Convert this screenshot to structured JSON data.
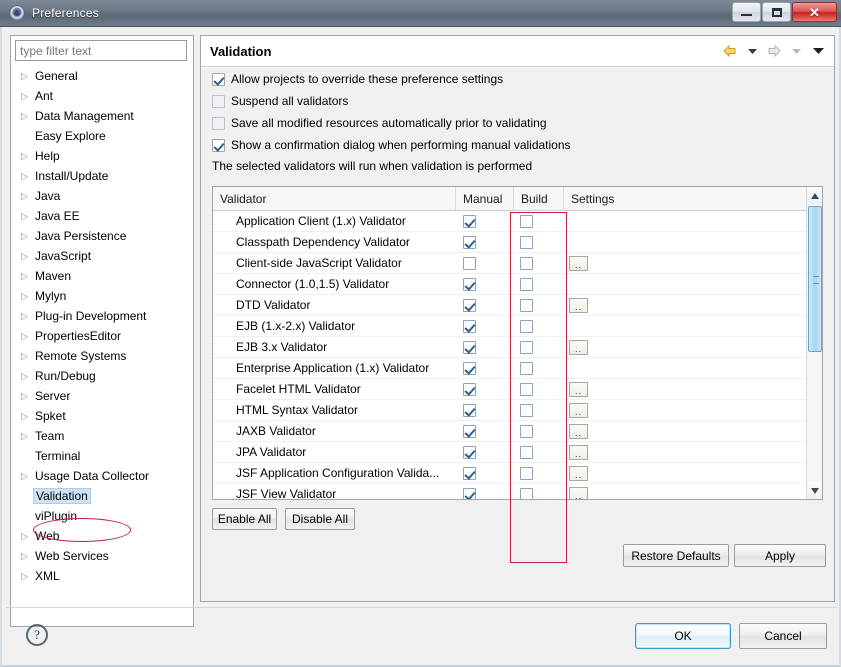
{
  "window": {
    "title": "Preferences",
    "icon": "preferences-gear-icon",
    "controls": {
      "minimize": "minimize-icon",
      "maximize": "maximize-icon",
      "close": "✕"
    }
  },
  "sidebar": {
    "filter_placeholder": "type filter text",
    "filter_value": "",
    "items": [
      {
        "label": "General",
        "expandable": true,
        "selected": false
      },
      {
        "label": "Ant",
        "expandable": true,
        "selected": false
      },
      {
        "label": "Data Management",
        "expandable": true,
        "selected": false
      },
      {
        "label": "Easy Explore",
        "expandable": false,
        "selected": false
      },
      {
        "label": "Help",
        "expandable": true,
        "selected": false
      },
      {
        "label": "Install/Update",
        "expandable": true,
        "selected": false
      },
      {
        "label": "Java",
        "expandable": true,
        "selected": false
      },
      {
        "label": "Java EE",
        "expandable": true,
        "selected": false
      },
      {
        "label": "Java Persistence",
        "expandable": true,
        "selected": false
      },
      {
        "label": "JavaScript",
        "expandable": true,
        "selected": false
      },
      {
        "label": "Maven",
        "expandable": true,
        "selected": false
      },
      {
        "label": "Mylyn",
        "expandable": true,
        "selected": false
      },
      {
        "label": "Plug-in Development",
        "expandable": true,
        "selected": false
      },
      {
        "label": "PropertiesEditor",
        "expandable": true,
        "selected": false
      },
      {
        "label": "Remote Systems",
        "expandable": true,
        "selected": false
      },
      {
        "label": "Run/Debug",
        "expandable": true,
        "selected": false
      },
      {
        "label": "Server",
        "expandable": true,
        "selected": false
      },
      {
        "label": "Spket",
        "expandable": true,
        "selected": false
      },
      {
        "label": "Team",
        "expandable": true,
        "selected": false
      },
      {
        "label": "Terminal",
        "expandable": false,
        "selected": false
      },
      {
        "label": "Usage Data Collector",
        "expandable": true,
        "selected": false
      },
      {
        "label": "Validation",
        "expandable": false,
        "selected": true
      },
      {
        "label": "viPlugin",
        "expandable": false,
        "selected": false
      },
      {
        "label": "Web",
        "expandable": true,
        "selected": false
      },
      {
        "label": "Web Services",
        "expandable": true,
        "selected": false
      },
      {
        "label": "XML",
        "expandable": true,
        "selected": false
      }
    ]
  },
  "content": {
    "title": "Validation",
    "nav": {
      "back": "back-arrow-icon",
      "back_menu": "chevron-down-icon",
      "forward": "forward-arrow-icon",
      "forward_menu": "chevron-down-icon",
      "menu": "chevron-down-icon"
    },
    "options": [
      {
        "label": "Allow projects to override these preference settings",
        "checked": true,
        "enabled": true
      },
      {
        "label": "Suspend all validators",
        "checked": false,
        "enabled": false
      },
      {
        "label": "Save all modified resources automatically prior to validating",
        "checked": false,
        "enabled": false
      },
      {
        "label": "Show a confirmation dialog when performing manual validations",
        "checked": true,
        "enabled": true
      }
    ],
    "note": "The selected validators will run when validation is performed",
    "table": {
      "columns": [
        "Validator",
        "Manual",
        "Build",
        "Settings"
      ],
      "rows": [
        {
          "validator": "Application Client (1.x) Validator",
          "manual": true,
          "build": false,
          "settings": false
        },
        {
          "validator": "Classpath Dependency Validator",
          "manual": true,
          "build": false,
          "settings": false
        },
        {
          "validator": "Client-side JavaScript Validator",
          "manual": false,
          "build": false,
          "settings": true
        },
        {
          "validator": "Connector (1.0,1.5) Validator",
          "manual": true,
          "build": false,
          "settings": false
        },
        {
          "validator": "DTD Validator",
          "manual": true,
          "build": false,
          "settings": true
        },
        {
          "validator": "EJB (1.x-2.x) Validator",
          "manual": true,
          "build": false,
          "settings": false
        },
        {
          "validator": "EJB 3.x Validator",
          "manual": true,
          "build": false,
          "settings": true
        },
        {
          "validator": "Enterprise Application (1.x) Validator",
          "manual": true,
          "build": false,
          "settings": false
        },
        {
          "validator": "Facelet HTML Validator",
          "manual": true,
          "build": false,
          "settings": true
        },
        {
          "validator": "HTML Syntax Validator",
          "manual": true,
          "build": false,
          "settings": true
        },
        {
          "validator": "JAXB Validator",
          "manual": true,
          "build": false,
          "settings": true
        },
        {
          "validator": "JPA Validator",
          "manual": true,
          "build": false,
          "settings": true
        },
        {
          "validator": "JSF Application Configuration Valida...",
          "manual": true,
          "build": false,
          "settings": true
        },
        {
          "validator": "JSF View Validator",
          "manual": true,
          "build": false,
          "settings": true
        }
      ],
      "settings_button_label": ".."
    },
    "buttons": {
      "enable_all": "Enable All",
      "disable_all": "Disable All",
      "restore_defaults": "Restore Defaults",
      "apply": "Apply"
    }
  },
  "footer": {
    "help": "?",
    "ok": "OK",
    "cancel": "Cancel"
  },
  "annotations": {
    "ellipse_target": "Validation",
    "rectangle_target": "Build"
  },
  "colors": {
    "accent_selection": "#cde3f5",
    "annotation_red": "#c0213c",
    "checkbox_check": "#2f5e8f",
    "scrollbar_thumb": "#a8d4f0",
    "titlebar": "#6e7a88",
    "close_button": "#c52020"
  }
}
